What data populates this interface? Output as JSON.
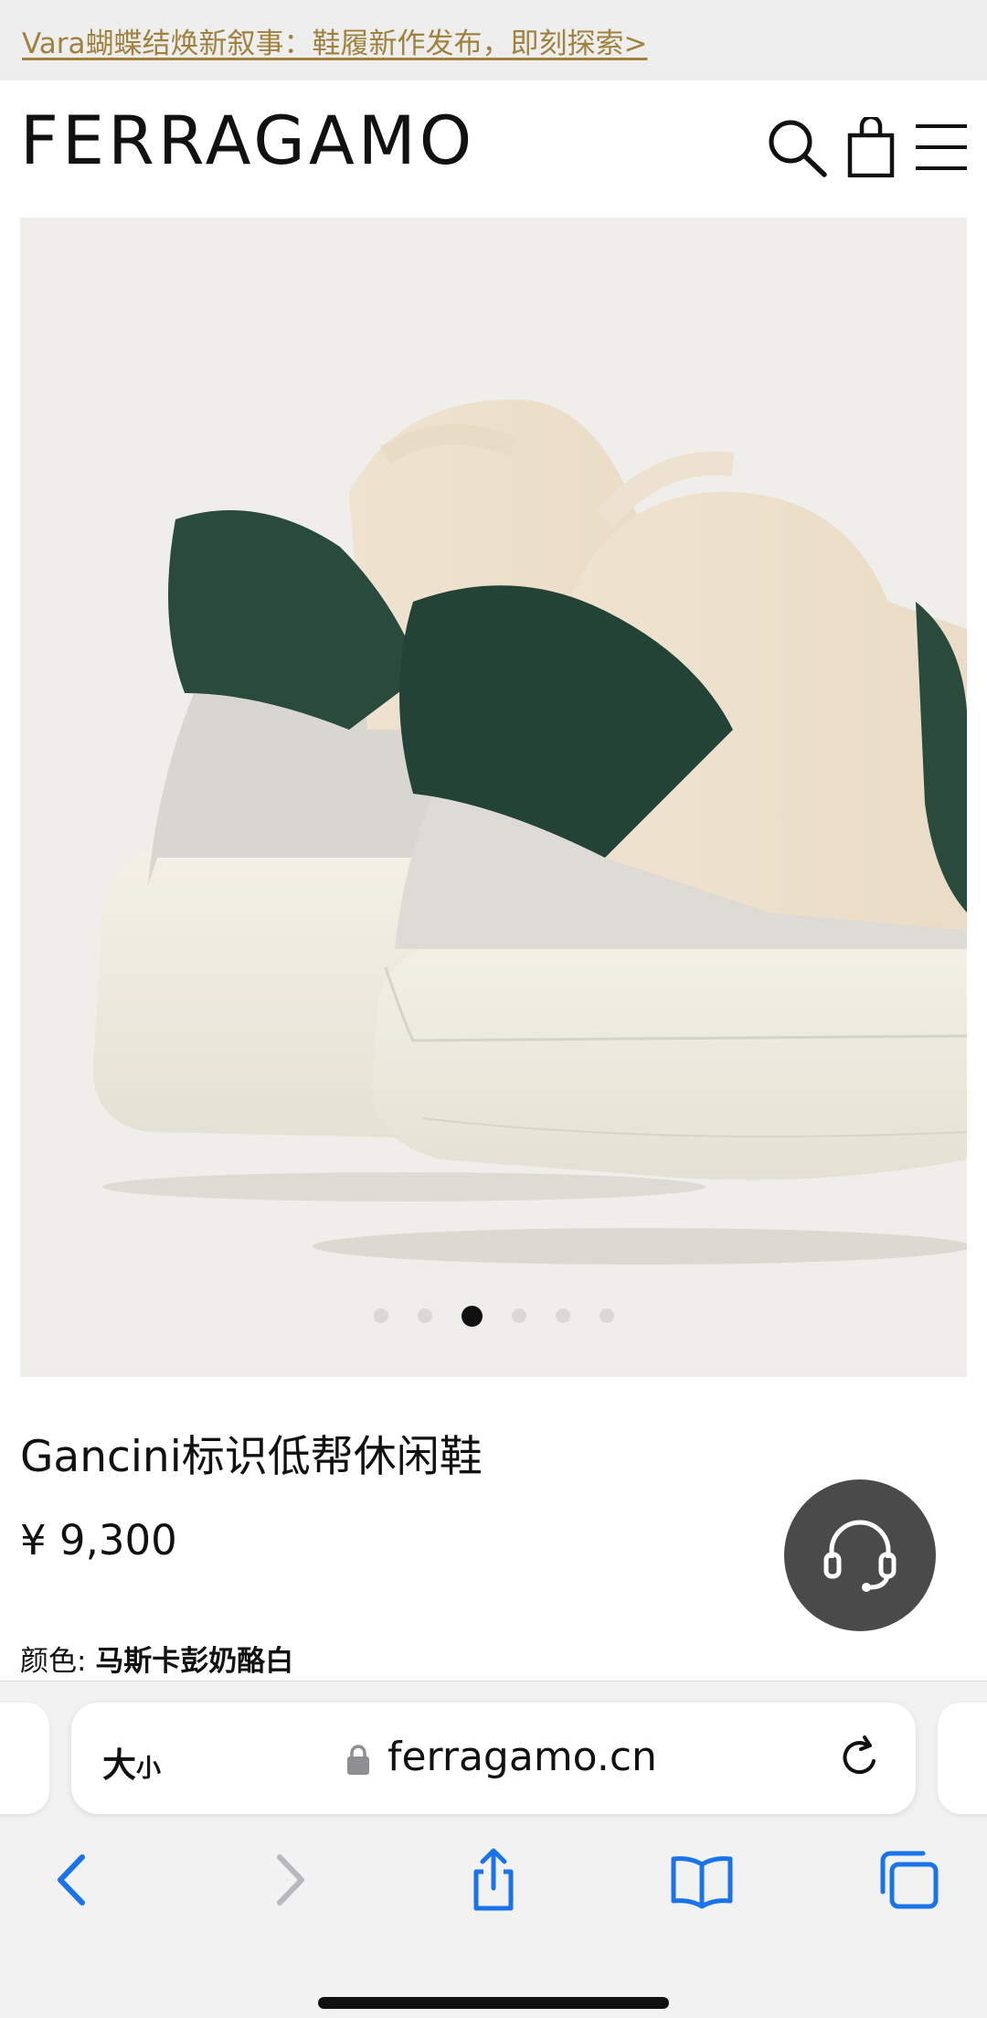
{
  "promo_banner": {
    "text": "Vara蝴蝶结焕新叙事：鞋履新作发布，即刻探索>"
  },
  "header": {
    "logo": "FERRAGAMO",
    "icons": [
      "search-icon",
      "shopping-bag-icon",
      "menu-icon"
    ]
  },
  "gallery": {
    "image": "cream leather low-top sneakers with green textured heel tab",
    "slide_count": 6,
    "active_slide": 3
  },
  "product": {
    "title": "Gancini标识低帮休闲鞋",
    "price": "¥ 9,300",
    "color_label": "颜色: ",
    "color_value": "马斯卡彭奶酪白"
  },
  "customer_service": {
    "icon": "headset-icon"
  },
  "browser": {
    "text_size_large": "大",
    "text_size_small": "小",
    "url": "ferragamo.cn",
    "toolbar": [
      "back-icon",
      "forward-icon",
      "share-icon",
      "bookmarks-icon",
      "tabs-icon"
    ]
  },
  "colors": {
    "promo_text": "#a0823e",
    "promo_bg": "#eeeeee",
    "gallery_bg": "#efeeeb",
    "accent_blue": "#1a73e8",
    "cs_button": "#4a4a4a"
  }
}
